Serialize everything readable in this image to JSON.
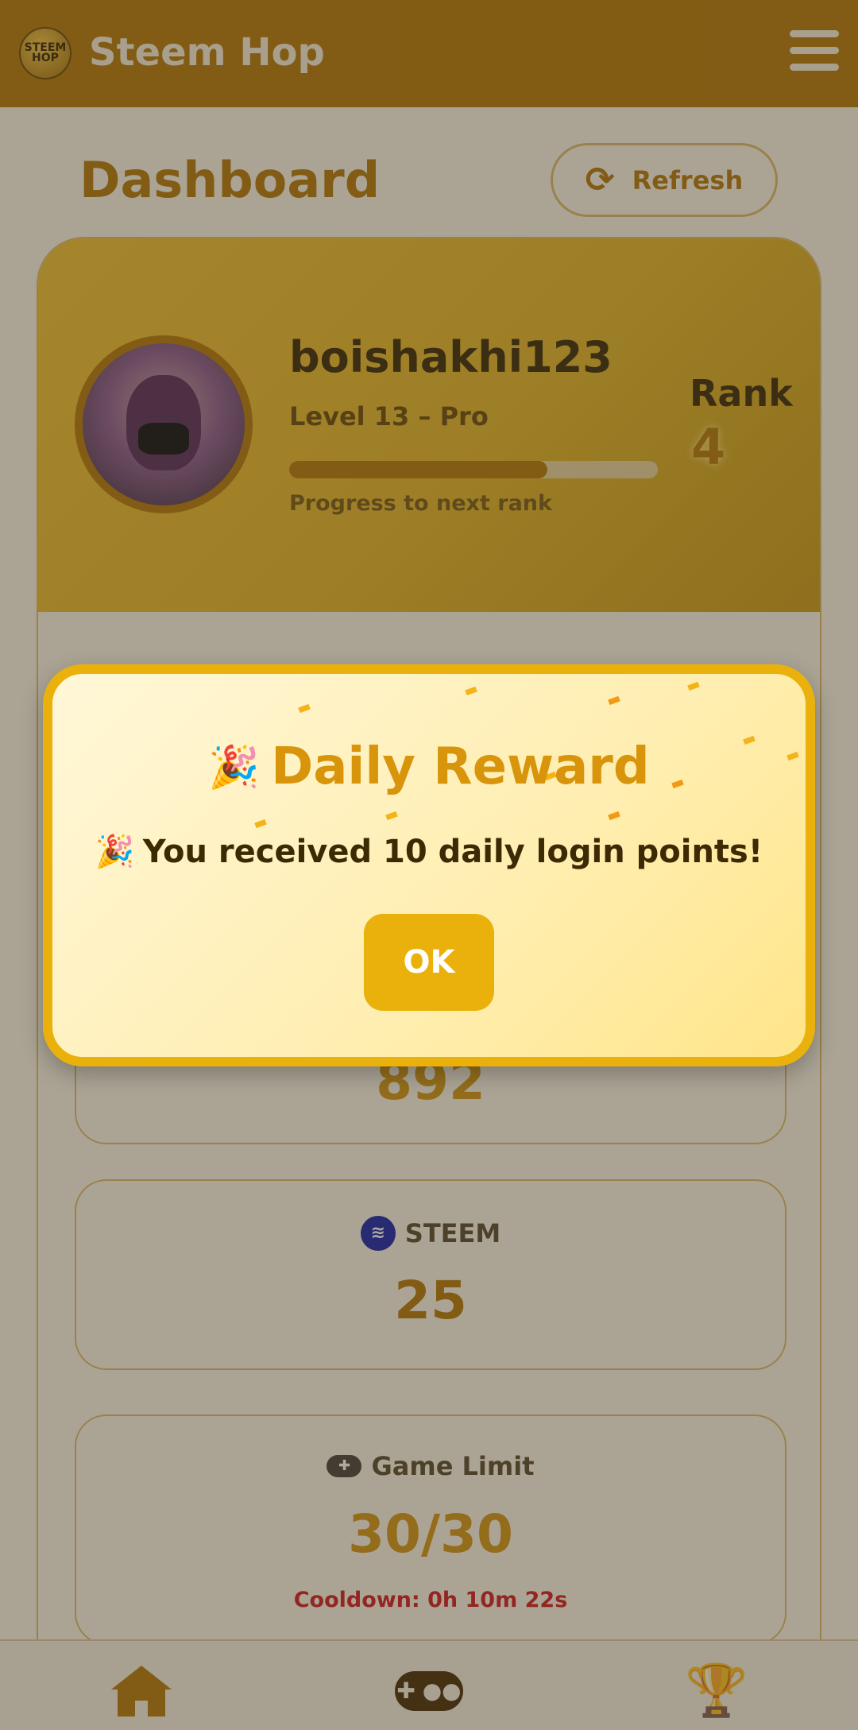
{
  "header": {
    "app_title": "Steem Hop",
    "logo_text": "STEEM HOP",
    "menu_icon": "hamburger-icon"
  },
  "dashboard": {
    "title": "Dashboard",
    "refresh_label": "Refresh",
    "refresh_icon": "refresh-icon"
  },
  "profile": {
    "username": "boishakhi123",
    "level_text": "Level 13 – Pro",
    "progress_fraction": 0.7,
    "progress_label": "Progress to next rank",
    "rank_label": "Rank",
    "rank_value": "4"
  },
  "stats": {
    "points_partial_value": "892",
    "steem": {
      "label": "STEEM",
      "value": "25",
      "icon": "steem-icon"
    },
    "game_limit": {
      "label": "Game Limit",
      "value": "30/30",
      "cooldown": "Cooldown: 0h 10m 22s",
      "icon": "gamepad-icon"
    }
  },
  "modal": {
    "title": "Daily Reward",
    "title_emoji": "🎉",
    "message": "You received 10 daily login points!",
    "message_emoji": "🎉",
    "ok_label": "OK"
  },
  "bottom_nav": {
    "items": [
      "home-icon",
      "gamepad-icon",
      "trophy-icon"
    ]
  },
  "colors": {
    "brand": "#b67906",
    "accent": "#eab10c",
    "cooldown": "#d21d1d"
  }
}
